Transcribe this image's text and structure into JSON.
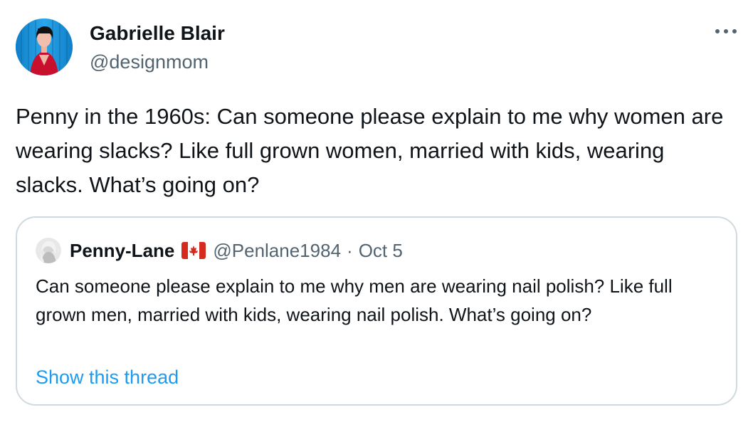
{
  "author": {
    "display_name": "Gabrielle Blair",
    "handle": "@designmom",
    "avatar_icon": "profile-photo"
  },
  "tweet": {
    "text": "Penny in the 1960s: Can someone please explain to me why women are wearing slacks? Like full grown women, married with kids, wearing slacks. What’s going on?"
  },
  "menu": {
    "more_icon": "more-dots-icon"
  },
  "quoted_tweet": {
    "display_name": "Penny-Lane",
    "flag_icon": "canada-flag-icon",
    "handle": "@Penlane1984",
    "separator": "·",
    "date": "Oct 5",
    "text": "Can someone please explain to me why men are wearing nail polish? Like full grown men, married with kids, wearing nail polish. What’s going on?",
    "show_thread_label": "Show this thread"
  },
  "colors": {
    "text_primary": "#0f1419",
    "text_secondary": "#536471",
    "link": "#1d9bf0",
    "border": "#cfd9de"
  }
}
